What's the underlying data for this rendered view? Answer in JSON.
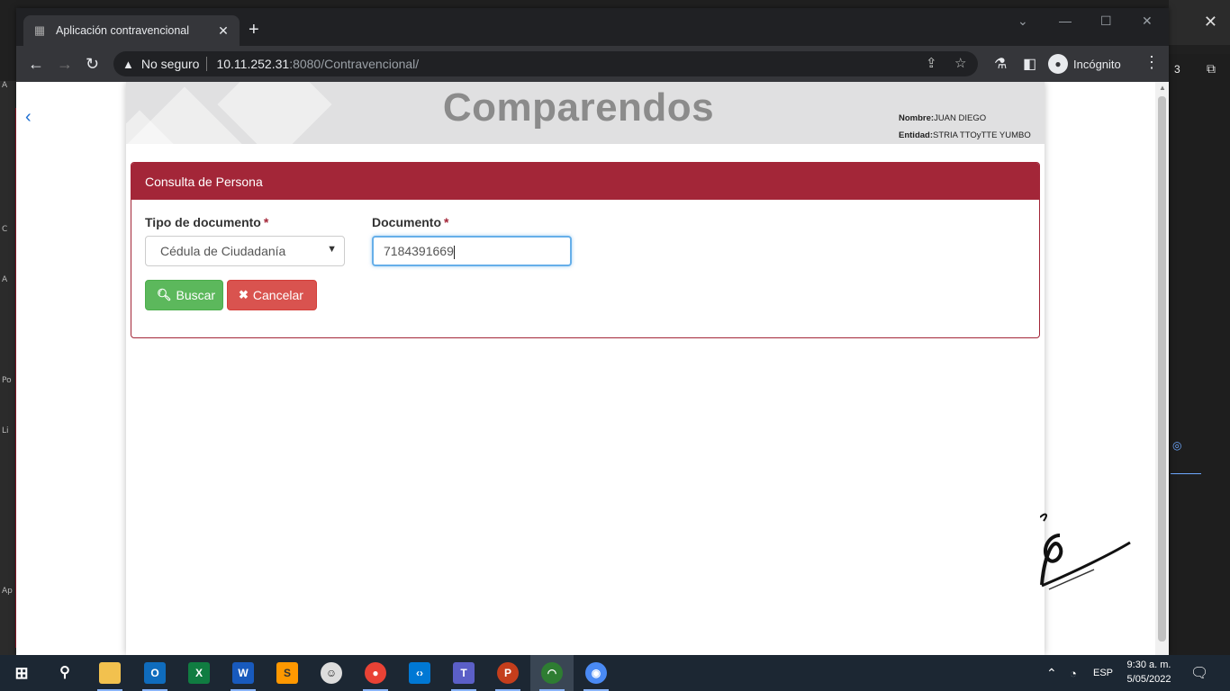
{
  "browser": {
    "tab_title": "Aplicación contravencional",
    "tab_close": "✕",
    "new_tab": "+",
    "security_label": "No seguro",
    "url_host": "10.11.252.31",
    "url_path": ":8080/Contravencional/",
    "profile_label": "Incógnito"
  },
  "background_app": {
    "counter": "3",
    "left_marks": [
      "A",
      "C",
      "A",
      "Po",
      "Li",
      "Ap"
    ]
  },
  "header": {
    "title": "Comparendos",
    "user_name_label": "Nombre:",
    "user_name_value": "JUAN DIEGO",
    "entity_label": "Entidad:",
    "entity_value": "STRIA TTOyTTE YUMBO"
  },
  "panel": {
    "heading": "Consulta de Persona",
    "doc_type_label": "Tipo de documento",
    "doc_type_value": "Cédula de Ciudadanía",
    "doc_label": "Documento",
    "doc_value": "7184391669",
    "required_mark": "*",
    "search_button": "Buscar",
    "cancel_button": "Cancelar"
  },
  "taskbar": {
    "language": "ESP",
    "time": "9:30 a. m.",
    "date": "5/05/2022",
    "apps": [
      "start",
      "search",
      "file-explorer",
      "outlook",
      "excel",
      "word",
      "sublime-text",
      "git-kraken",
      "chrome",
      "vscode",
      "teams",
      "powerpoint",
      "app-mask",
      "chromium"
    ]
  },
  "colors": {
    "brand": "#a32638",
    "success": "#5cb85c",
    "danger": "#d9534f",
    "focus": "#66afe9"
  }
}
